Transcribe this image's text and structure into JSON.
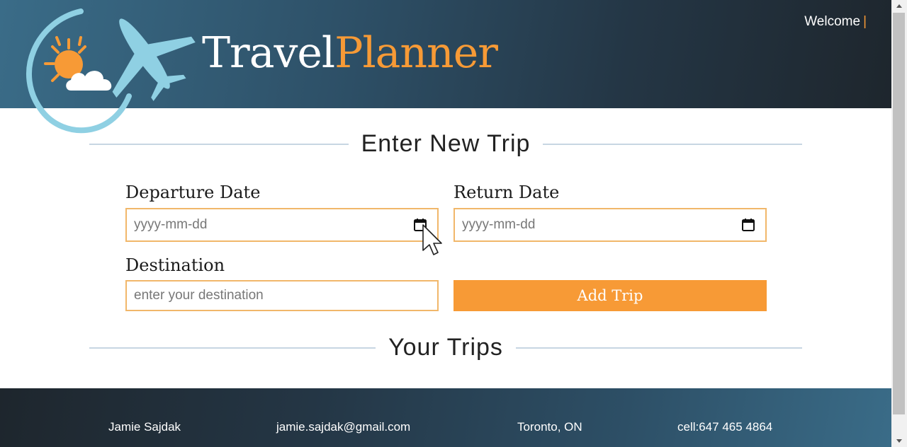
{
  "header": {
    "brand_part1": "Travel",
    "brand_part2": "Planner",
    "welcome": "Welcome",
    "welcome_bar": "|"
  },
  "form": {
    "title": "Enter New Trip",
    "departure_label": "Departure Date",
    "departure_placeholder": "yyyy-mm-dd",
    "return_label": "Return Date",
    "return_placeholder": "yyyy-mm-dd",
    "destination_label": "Destination",
    "destination_placeholder": "enter your destination",
    "add_button": "Add Trip"
  },
  "trips": {
    "title": "Your Trips"
  },
  "footer": {
    "name": "Jamie Sajdak",
    "email": "jamie.sajdak@gmail.com",
    "location": "Toronto, ON",
    "cell": "cell:647 465 4864"
  },
  "colors": {
    "accent": "#f79a36",
    "input_border": "#f1b76a",
    "header_dark": "#1e262d",
    "header_blue": "#3a6c88"
  },
  "icons": [
    "logo-plane-sun-cloud-icon",
    "calendar-icon",
    "mouse-cursor-icon"
  ]
}
